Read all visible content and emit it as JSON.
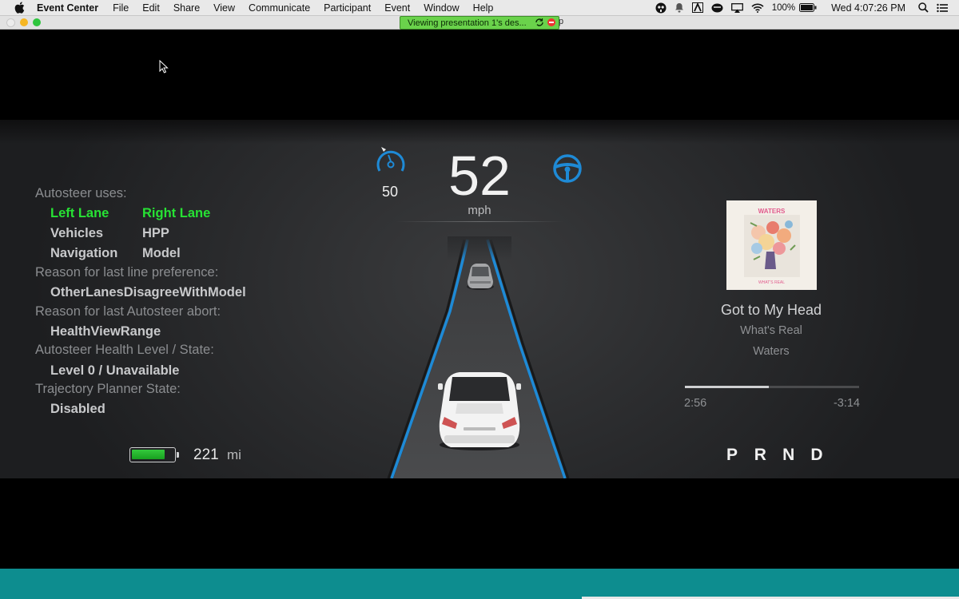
{
  "menubar": {
    "app_name": "Event Center",
    "items": [
      "File",
      "Edit",
      "Share",
      "View",
      "Communicate",
      "Participant",
      "Event",
      "Window",
      "Help"
    ],
    "battery_percent": "100%",
    "clock": "Wed 4:07:26 PM",
    "status_icons": [
      "webex-icon",
      "notification-bell-icon",
      "adobe-icon",
      "coffee-icon",
      "airplay-icon",
      "wifi-icon",
      "battery-icon",
      "spotlight-search-icon",
      "notification-center-icon"
    ]
  },
  "window": {
    "share_banner": "Viewing presentation 1's des...",
    "banner_tail": "p"
  },
  "autopilot": {
    "speed": "52",
    "speed_unit": "mph",
    "speed_limit": "50",
    "uses_header": "Autosteer uses:",
    "sources": [
      {
        "label": "Left Lane",
        "active": true
      },
      {
        "label": "Right Lane",
        "active": true
      },
      {
        "label": "Vehicles",
        "active": false
      },
      {
        "label": "HPP",
        "active": false
      },
      {
        "label": "Navigation",
        "active": false
      },
      {
        "label": "Model",
        "active": false
      }
    ],
    "lane_pref_header": "Reason for last line preference:",
    "lane_pref_value": "OtherLanesDisagreeWithModel",
    "abort_header": "Reason for last Autosteer abort:",
    "abort_value": "HealthViewRange",
    "health_header": "Autosteer Health Level / State:",
    "health_value": "Level  0  / Unavailable",
    "planner_header": "Trajectory Planner State:",
    "planner_value": "Disabled",
    "range_value": "221",
    "range_unit": "mi",
    "battery_level": 0.78
  },
  "media": {
    "album_art_text_top": "WATERS",
    "album_art_text_bottom": "WHAT'S REAL",
    "song_title": "Got to My Head",
    "album": "What's Real",
    "artist": "Waters",
    "elapsed": "2:56",
    "remaining": "-3:14",
    "progress": 0.48
  },
  "gears": [
    "P",
    "R",
    "N",
    "D"
  ],
  "colors": {
    "lane_blue": "#1e8ad6",
    "active_green": "#27e234",
    "teal_bar": "#0d8d8f"
  }
}
